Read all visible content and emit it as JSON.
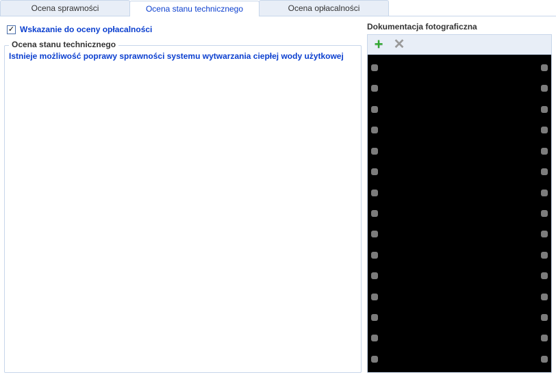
{
  "tabs": [
    {
      "id": "sprawnosci",
      "label": "Ocena sprawności",
      "active": false
    },
    {
      "id": "stanu",
      "label": "Ocena stanu technicznego",
      "active": true
    },
    {
      "id": "oplacalnosci",
      "label": "Ocena opłacalności",
      "active": false
    }
  ],
  "indication": {
    "checked": true,
    "checkmark": "✓",
    "label": "Wskazanie do oceny opłacalności"
  },
  "technical_group": {
    "title": "Ocena stanu technicznego",
    "message": "Istnieje możliwość poprawy sprawności systemu wytwarzania ciepłej wody użytkowej"
  },
  "docs": {
    "title": "Dokumentacja fotograficzna",
    "hole_count": 15
  }
}
